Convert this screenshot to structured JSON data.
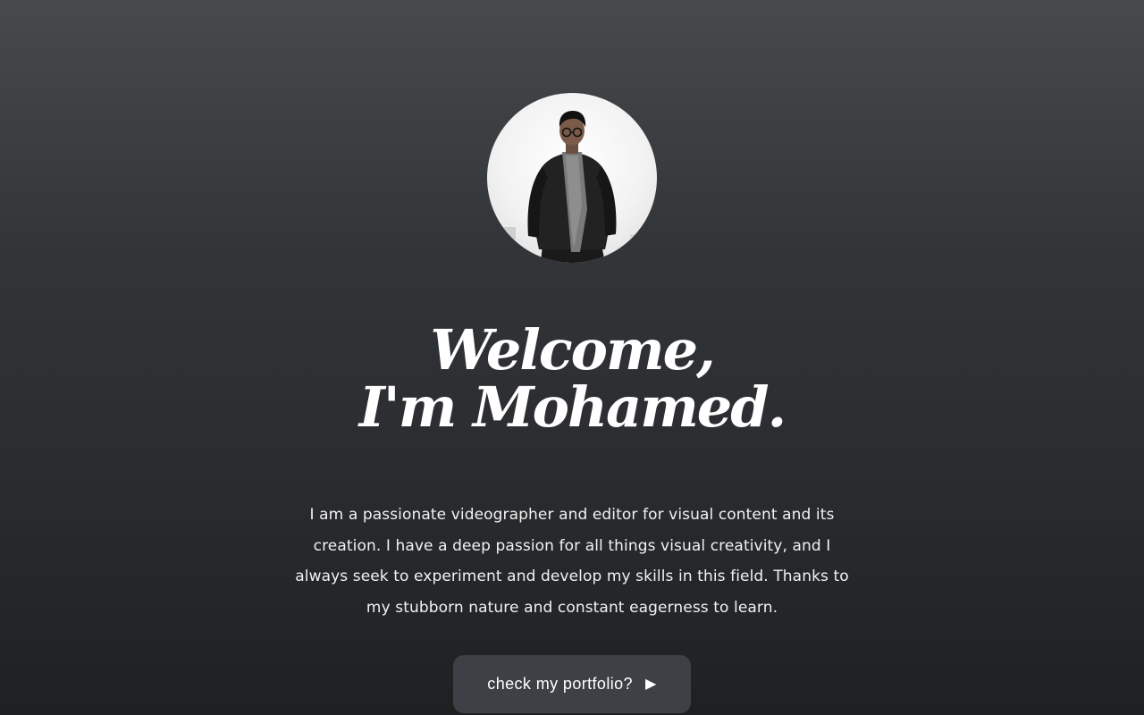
{
  "profile": {
    "avatar_alt": "Portrait photo",
    "avatar_icon": "person-photo"
  },
  "hero": {
    "line1": "Welcome,",
    "line2": "I'm Mohamed."
  },
  "bio": {
    "text": "I am a passionate videographer and editor for visual content and its creation. I have a deep passion for all things visual creativity, and I always seek to experiment and develop my skills in this field. Thanks to my stubborn nature and constant eagerness to learn."
  },
  "cta": {
    "label": "check my portfolio?",
    "icon": "play-icon",
    "icon_glyph": "▶"
  },
  "colors": {
    "background_top": "#47494c",
    "background_bottom": "#1e2022",
    "button_bg": "#3d4044",
    "text": "#ffffff"
  }
}
